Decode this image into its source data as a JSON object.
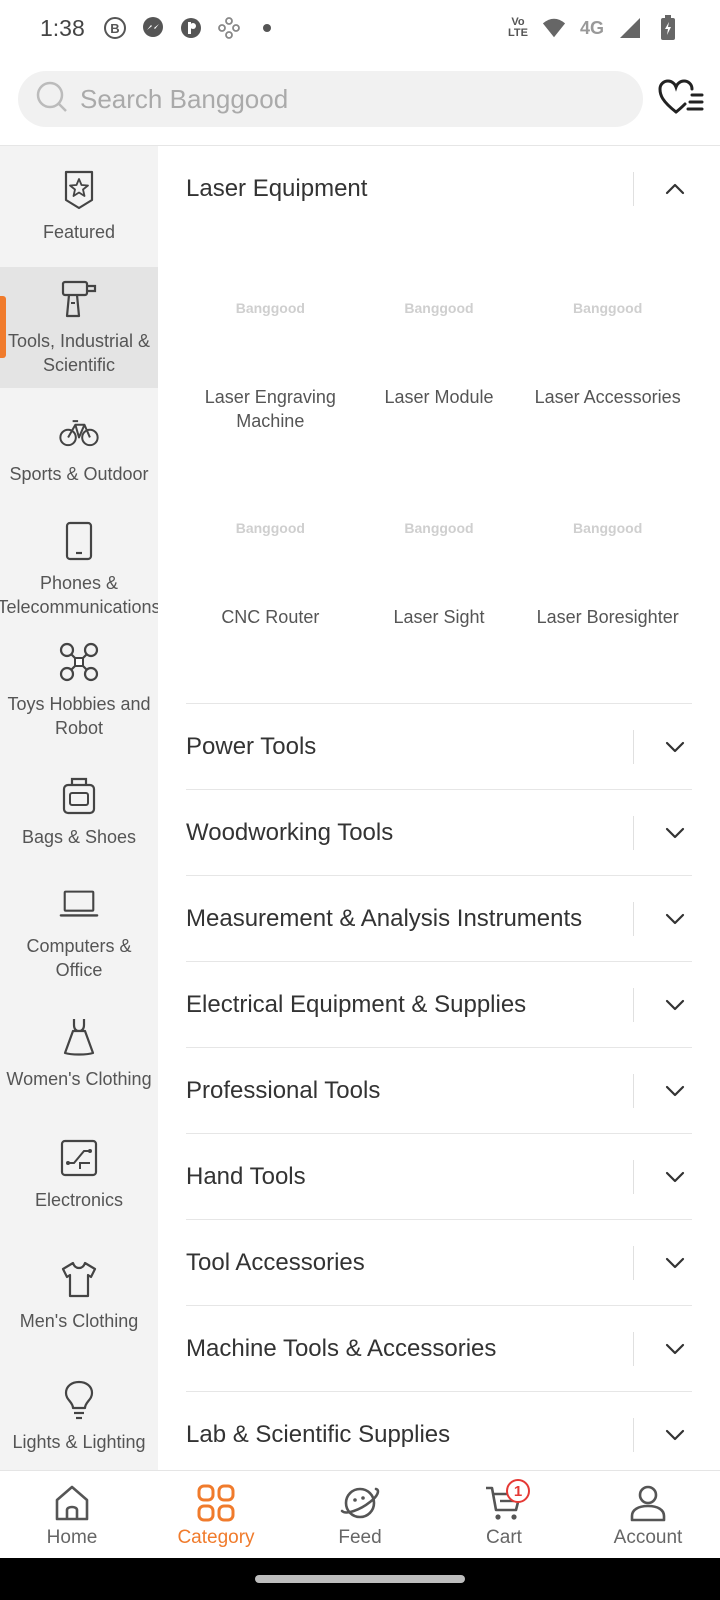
{
  "status": {
    "time": "1:38",
    "network_small_top": "Vo",
    "network_small_bottom": "LTE",
    "network_type": "4G"
  },
  "search": {
    "placeholder": "Search Banggood"
  },
  "sidebar": {
    "items": [
      {
        "label": "Featured",
        "icon": "star-badge-icon",
        "active": false
      },
      {
        "label": "Tools, Industrial & Scientific",
        "icon": "drill-icon",
        "active": true
      },
      {
        "label": "Sports & Outdoor",
        "icon": "bicycle-icon",
        "active": false
      },
      {
        "label": "Phones & Telecommunications",
        "icon": "phone-icon",
        "active": false
      },
      {
        "label": "Toys Hobbies and Robot",
        "icon": "drone-icon",
        "active": false
      },
      {
        "label": "Bags & Shoes",
        "icon": "bag-icon",
        "active": false
      },
      {
        "label": "Computers & Office",
        "icon": "laptop-icon",
        "active": false
      },
      {
        "label": "Women's Clothing",
        "icon": "dress-icon",
        "active": false
      },
      {
        "label": "Electronics",
        "icon": "circuit-icon",
        "active": false
      },
      {
        "label": "Men's Clothing",
        "icon": "shirt-icon",
        "active": false
      },
      {
        "label": "Lights & Lighting",
        "icon": "bulb-icon",
        "active": false
      }
    ]
  },
  "main": {
    "expanded": {
      "title": "Laser Equipment",
      "placeholder_text": "Banggood",
      "subcategories": [
        {
          "label": "Laser Engraving Machine"
        },
        {
          "label": "Laser Module"
        },
        {
          "label": "Laser Accessories"
        },
        {
          "label": "CNC Router"
        },
        {
          "label": "Laser Sight"
        },
        {
          "label": "Laser Boresighter"
        }
      ]
    },
    "collapsed": [
      {
        "title": "Power Tools"
      },
      {
        "title": "Woodworking Tools"
      },
      {
        "title": "Measurement & Analysis Instruments"
      },
      {
        "title": "Electrical Equipment & Supplies"
      },
      {
        "title": "Professional Tools"
      },
      {
        "title": "Hand Tools"
      },
      {
        "title": "Tool Accessories"
      },
      {
        "title": "Machine Tools & Accessories"
      },
      {
        "title": "Lab & Scientific Supplies"
      }
    ]
  },
  "nav": {
    "items": [
      {
        "label": "Home",
        "icon": "home-icon",
        "active": false
      },
      {
        "label": "Category",
        "icon": "category-grid-icon",
        "active": true
      },
      {
        "label": "Feed",
        "icon": "planet-icon",
        "active": false
      },
      {
        "label": "Cart",
        "icon": "cart-icon",
        "active": false
      },
      {
        "label": "Account",
        "icon": "person-icon",
        "active": false
      }
    ],
    "cart_count": "1"
  },
  "colors": {
    "accent": "#f07b2c",
    "badge": "#e53935"
  }
}
